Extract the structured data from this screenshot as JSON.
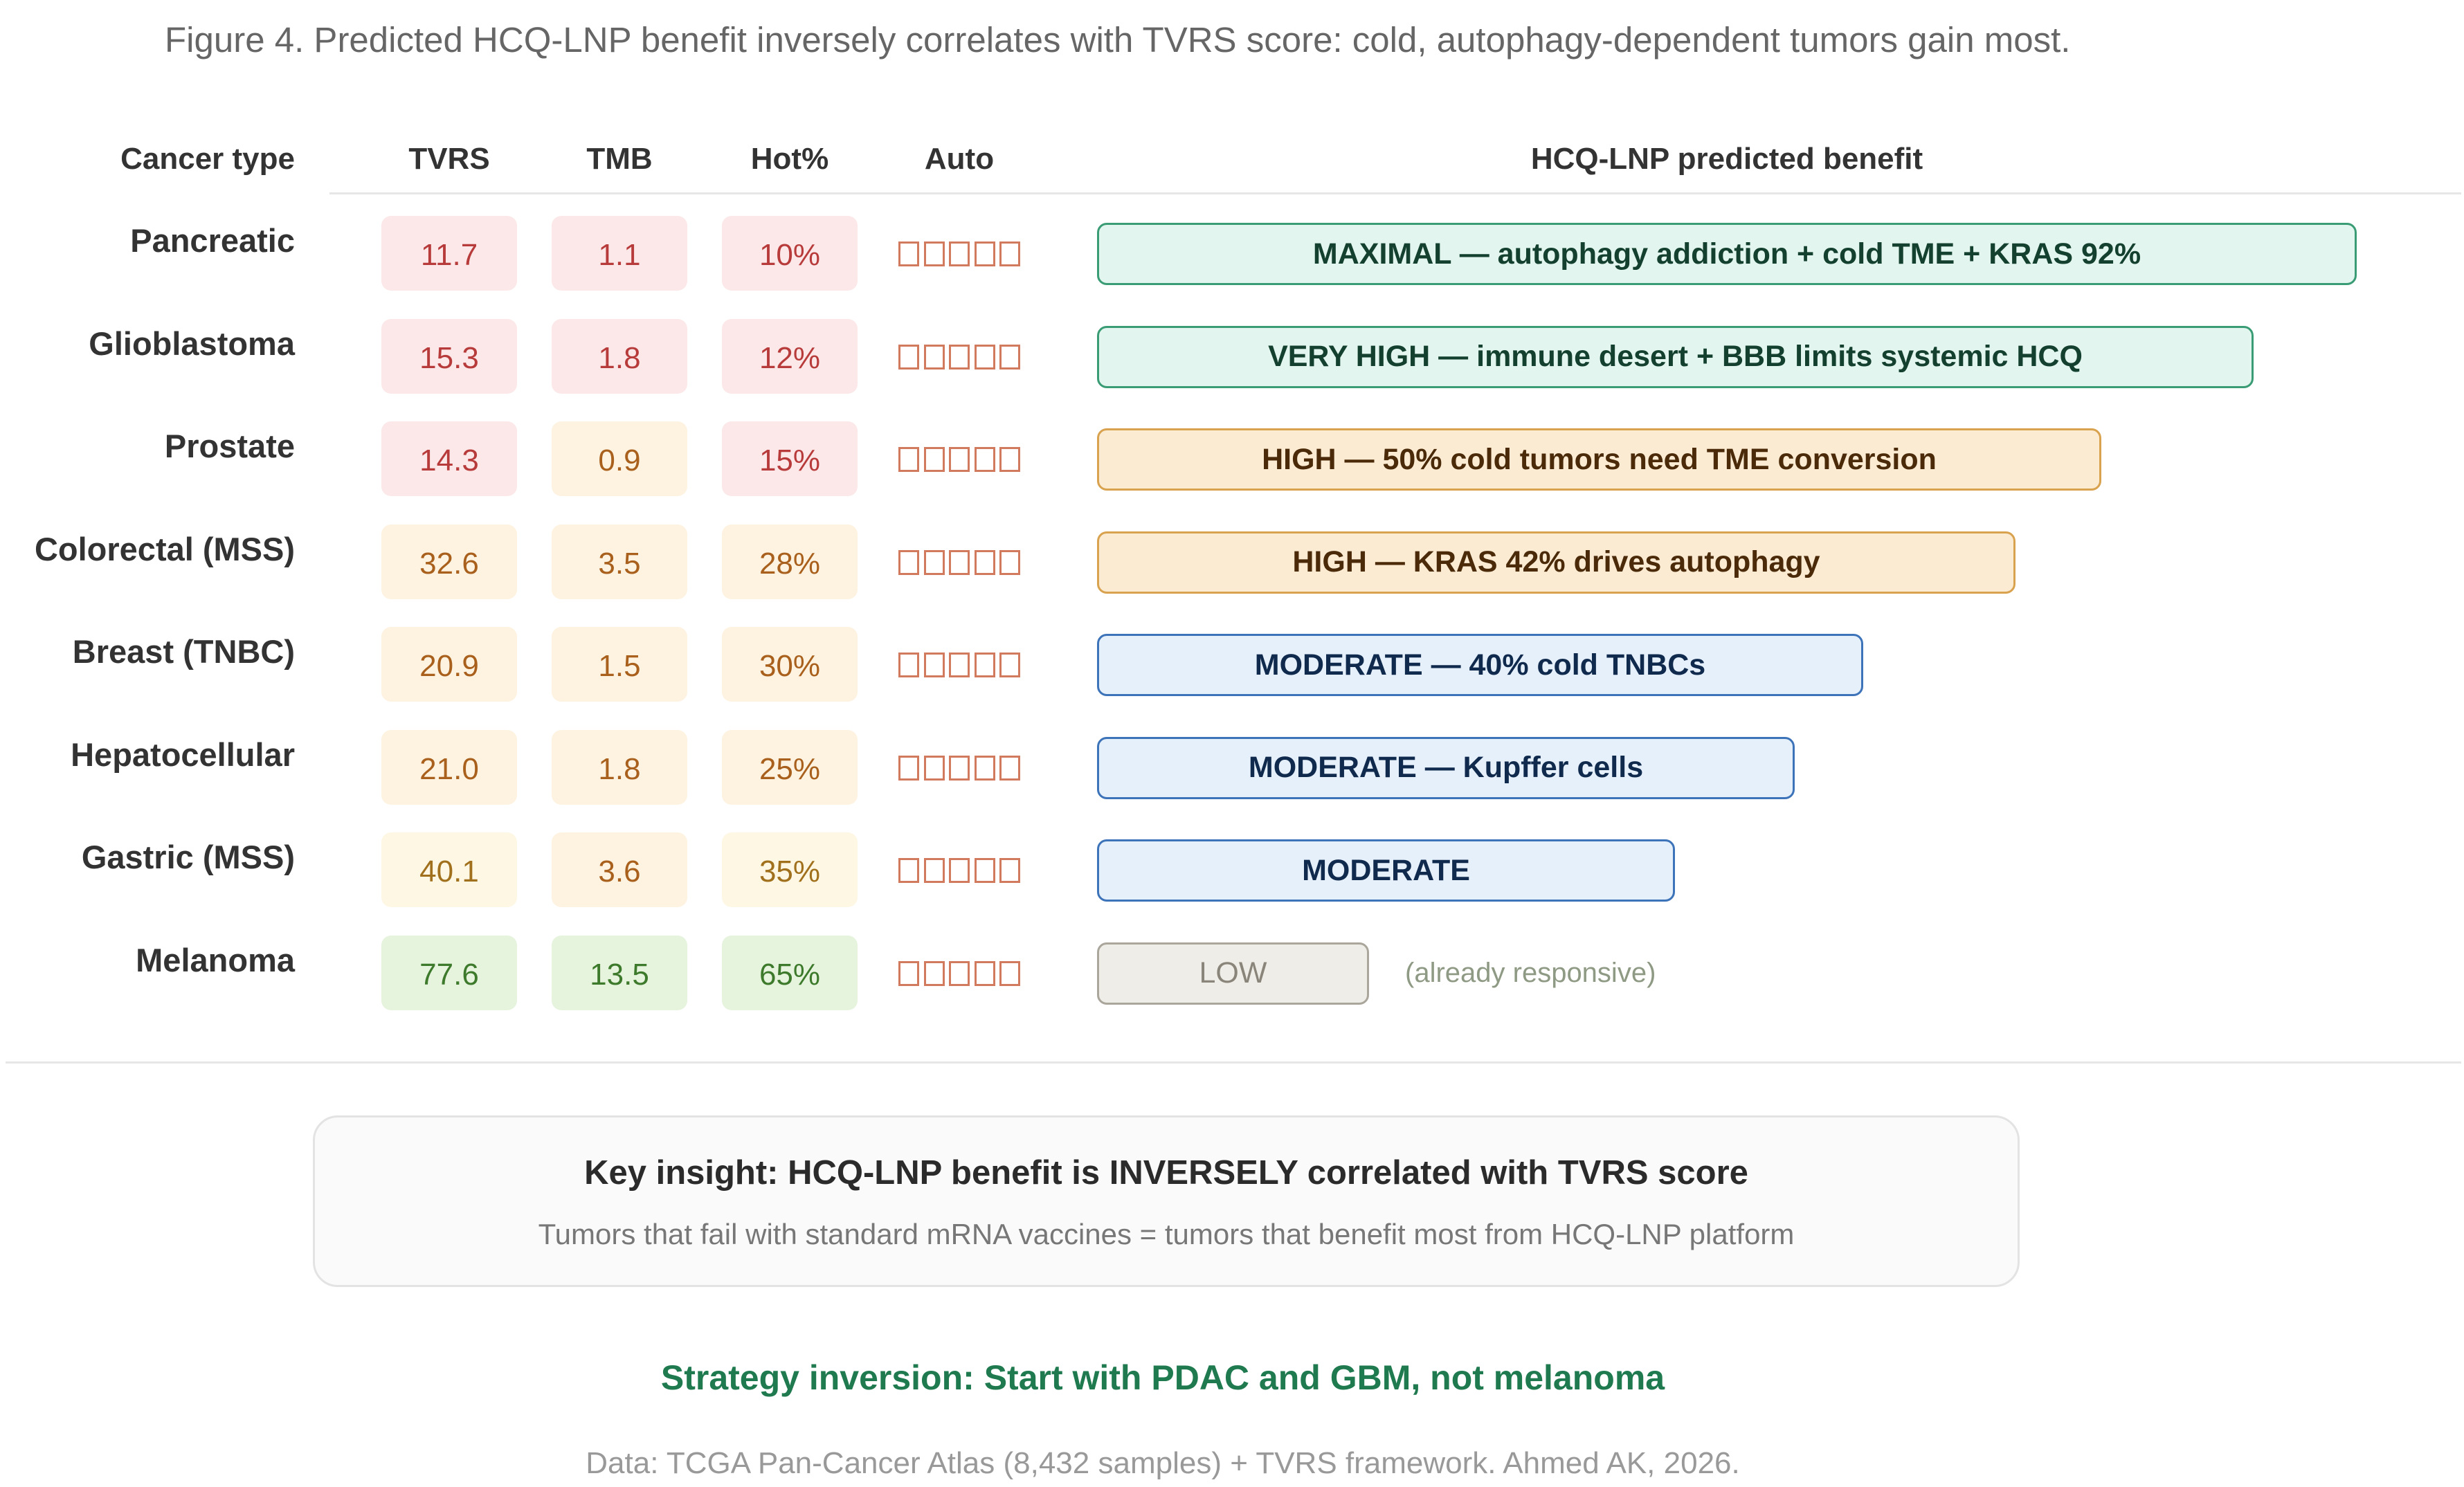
{
  "caption": "Figure 4. Predicted HCQ-LNP benefit inversely correlates with TVRS score: cold, autophagy-dependent tumors gain most.",
  "colors": {
    "red_cell": "#fce8e8",
    "orange_cell": "#fef2e0",
    "yellow_cell": "#fef7e4",
    "green_cell": "#e6f3dd",
    "maximal_bar": "#e2f5ee",
    "high_bar": "#fcebd3",
    "moderate_bar": "#e6f0fb",
    "low_bar": "#efede7",
    "strategy_text": "#1f7a4f"
  },
  "chart_data": {
    "type": "table",
    "columns": [
      "Cancer type",
      "TVRS",
      "TMB",
      "Hot%",
      "Auto",
      "HCQ-LNP predicted benefit"
    ],
    "rows": [
      {
        "cancer": "Pancreatic",
        "tvrs": "11.7",
        "tmb": "1.1",
        "hot": "10%",
        "auto": "□□□□□",
        "benefit": "MAXIMAL — autophagy addiction + cold TME + KRAS 92%",
        "benefit_score": 1.0,
        "tier": "maximal",
        "levels": [
          "red",
          "red",
          "red"
        ],
        "note": ""
      },
      {
        "cancer": "Glioblastoma",
        "tvrs": "15.3",
        "tmb": "1.8",
        "hot": "12%",
        "auto": "□□□□□",
        "benefit": "VERY HIGH — immune desert + BBB limits systemic HCQ",
        "benefit_score": 0.918,
        "tier": "veryhigh",
        "levels": [
          "red",
          "red",
          "red"
        ],
        "note": ""
      },
      {
        "cancer": "Prostate",
        "tvrs": "14.3",
        "tmb": "0.9",
        "hot": "15%",
        "auto": "□□□□□",
        "benefit": "HIGH — 50% cold tumors need TME conversion",
        "benefit_score": 0.797,
        "tier": "high",
        "levels": [
          "red",
          "orange",
          "red"
        ],
        "note": ""
      },
      {
        "cancer": "Colorectal (MSS)",
        "tvrs": "32.6",
        "tmb": "3.5",
        "hot": "28%",
        "auto": "□□□□□",
        "benefit": "HIGH — KRAS 42% drives autophagy",
        "benefit_score": 0.729,
        "tier": "high",
        "levels": [
          "orange",
          "orange",
          "orange"
        ],
        "note": ""
      },
      {
        "cancer": "Breast (TNBC)",
        "tvrs": "20.9",
        "tmb": "1.5",
        "hot": "30%",
        "auto": "□□□□□",
        "benefit": "MODERATE — 40% cold TNBCs",
        "benefit_score": 0.608,
        "tier": "moderate",
        "levels": [
          "orange",
          "orange",
          "orange"
        ],
        "note": ""
      },
      {
        "cancer": "Hepatocellular",
        "tvrs": "21.0",
        "tmb": "1.8",
        "hot": "25%",
        "auto": "□□□□□",
        "benefit": "MODERATE — Kupffer cells",
        "benefit_score": 0.554,
        "tier": "moderate",
        "levels": [
          "orange",
          "orange",
          "orange"
        ],
        "note": ""
      },
      {
        "cancer": "Gastric (MSS)",
        "tvrs": "40.1",
        "tmb": "3.6",
        "hot": "35%",
        "auto": "□□□□□",
        "benefit": "MODERATE",
        "benefit_score": 0.459,
        "tier": "moderate",
        "levels": [
          "yellow",
          "orange",
          "yellow"
        ],
        "note": ""
      },
      {
        "cancer": "Melanoma",
        "tvrs": "77.6",
        "tmb": "13.5",
        "hot": "65%",
        "auto": "□□□□□",
        "benefit": "LOW",
        "benefit_score": 0.216,
        "tier": "low",
        "levels": [
          "green",
          "green",
          "green"
        ],
        "note": "(already responsive)"
      }
    ]
  },
  "insight": {
    "title": "Key insight: HCQ-LNP benefit is INVERSELY correlated with TVRS score",
    "subtitle": "Tumors that fail with standard mRNA vaccines = tumors that benefit most from HCQ-LNP platform"
  },
  "strategy": "Strategy inversion: Start with PDAC and GBM, not melanoma",
  "source": "Data: TCGA Pan-Cancer Atlas (8,432 samples) + TVRS framework. Ahmed AK, 2026."
}
